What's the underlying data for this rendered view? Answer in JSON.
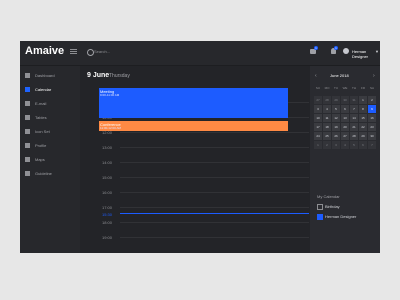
{
  "app": {
    "logo": "Amaive",
    "search_placeholder": "Search...",
    "notifications": {
      "mail": "1",
      "bell": "1"
    },
    "user": {
      "name": "Herman Designer"
    }
  },
  "sidebar": {
    "items": [
      {
        "label": "Dashboard",
        "icon": "dashboard-icon",
        "active": false
      },
      {
        "label": "Calendar",
        "icon": "calendar-icon",
        "active": true
      },
      {
        "label": "E-mail",
        "icon": "mail-icon",
        "active": false
      },
      {
        "label": "Tables",
        "icon": "table-icon",
        "active": false
      },
      {
        "label": "Icon Set",
        "icon": "icon-set-icon",
        "active": false
      },
      {
        "label": "Profile",
        "icon": "profile-icon",
        "active": false
      },
      {
        "label": "Maps",
        "icon": "map-icon",
        "active": false
      },
      {
        "label": "Guideline",
        "icon": "guide-icon",
        "active": false
      }
    ]
  },
  "main": {
    "day_number": "9 June",
    "day_name": "Thursday",
    "hours": [
      "10:00",
      "11:00",
      "12:00",
      "13:00",
      "14:00",
      "15:00",
      "16:00",
      "17:00",
      "18:00",
      "19:00"
    ],
    "current_time": "15:30",
    "events": [
      {
        "title": "Meeting",
        "time": "9:00-11:00 AM",
        "color": "#1d5cff"
      },
      {
        "title": "Conference",
        "time": "11:00-12:00 AM",
        "color": "#ff8a44"
      }
    ]
  },
  "calendar": {
    "month": "June 2018",
    "weekdays": [
      "SU",
      "MO",
      "TU",
      "WE",
      "TH",
      "FR",
      "SA"
    ],
    "days": [
      [
        "27",
        "28",
        "29",
        "30",
        "31",
        "1",
        "2"
      ],
      [
        "3",
        "4",
        "5",
        "6",
        "7",
        "8",
        "9"
      ],
      [
        "10",
        "11",
        "12",
        "13",
        "14",
        "15",
        "16"
      ],
      [
        "17",
        "18",
        "19",
        "20",
        "21",
        "22",
        "23"
      ],
      [
        "24",
        "25",
        "26",
        "27",
        "28",
        "29",
        "30"
      ],
      [
        "1",
        "2",
        "3",
        "4",
        "5",
        "6",
        "7"
      ]
    ],
    "selected_day": "9",
    "my_calendar_title": "My Calendar",
    "calendars": [
      {
        "label": "Birthday",
        "checked": false
      },
      {
        "label": "Herman Designer",
        "checked": true
      }
    ]
  },
  "colors": {
    "accent": "#1d5cff",
    "conference": "#ff8a44"
  }
}
